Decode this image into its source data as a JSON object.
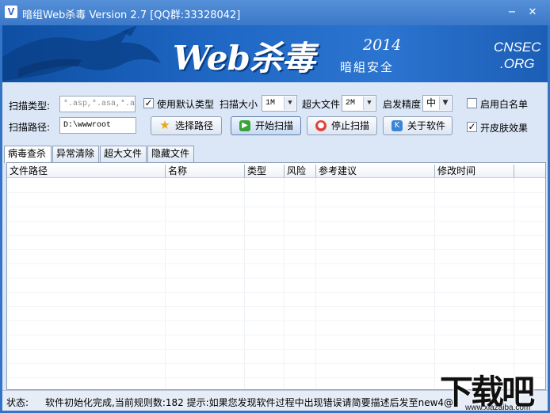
{
  "window": {
    "title": "暗组Web杀毒   Version 2.7   [QQ群:33328042]",
    "icon_letter": "V",
    "minimize": "−",
    "close": "✕"
  },
  "banner": {
    "title": "Web杀毒",
    "year": "2014",
    "subtitle": "暗組安全",
    "org_line1": "CNSEC",
    "org_line2": ".ORG"
  },
  "controls": {
    "scan_type_label": "扫描类型:",
    "scan_type_value": "*.asp,*.asa,*.a",
    "use_default_type": {
      "label": "使用默认类型",
      "checked": true,
      "mark": "✓"
    },
    "scan_size_label": "扫描大小",
    "scan_size_value": "1M",
    "large_file_label": "超大文件",
    "large_file_value": "2M",
    "heuristic_label": "启发精度",
    "heuristic_value": "中",
    "whitelist": {
      "label": "启用白名单",
      "checked": false,
      "mark": ""
    },
    "scan_path_label": "扫描路径:",
    "scan_path_value": "D:\\wwwroot",
    "skin_effect": {
      "label": "开皮肤效果",
      "checked": true,
      "mark": "✓"
    },
    "combo_arrow": "▼"
  },
  "buttons": {
    "select_path": "选择路径",
    "start_scan": "开始扫描",
    "stop_scan": "停止扫描",
    "about": "关于软件"
  },
  "tabs": [
    "病毒查杀",
    "异常清除",
    "超大文件",
    "隐藏文件"
  ],
  "table": {
    "columns": [
      "文件路径",
      "名称",
      "类型",
      "风险",
      "参考建议",
      "修改时间"
    ],
    "rows": []
  },
  "status": {
    "label": "状态:",
    "text": "软件初始化完成,当前规则数:182 提示:如果您发现软件过程中出现错误请简要描述后发至new4@"
  },
  "watermark": {
    "text": "下载吧",
    "url": "www.xiazaiba.com"
  },
  "colors": {
    "titlebar": "#3b78c8",
    "banner": "#1f68c5",
    "content_bg": "#dbe7f6"
  }
}
